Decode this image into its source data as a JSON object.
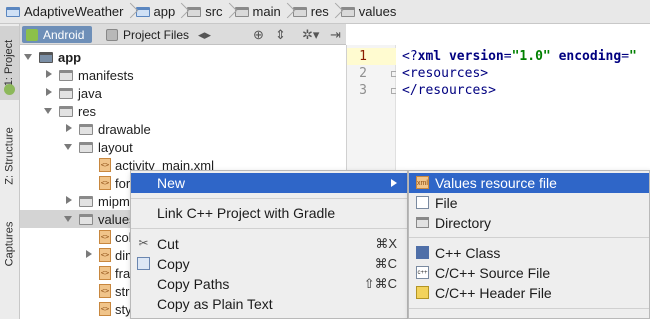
{
  "breadcrumb": [
    "AdaptiveWeather",
    "app",
    "src",
    "main",
    "res",
    "values"
  ],
  "side_tabs": {
    "project": "1: Project",
    "structure": "Z: Structure",
    "captures": "Captures"
  },
  "project_header": {
    "android_tab": "Android",
    "project_files_tab": "Project Files"
  },
  "tree": [
    {
      "label": "app",
      "type": "app",
      "arrow": "down"
    },
    {
      "label": "manifests",
      "type": "folder",
      "arrow": "right"
    },
    {
      "label": "java",
      "type": "folder",
      "arrow": "right"
    },
    {
      "label": "res",
      "type": "folder",
      "arrow": "down"
    },
    {
      "label": "drawable",
      "type": "folder",
      "arrow": "right"
    },
    {
      "label": "layout",
      "type": "folder",
      "arrow": "down"
    },
    {
      "label": "activity_main.xml",
      "type": "xml",
      "arrow": ""
    },
    {
      "label": "fore",
      "type": "xml",
      "arrow": ""
    },
    {
      "label": "mipma",
      "type": "folder",
      "arrow": "right"
    },
    {
      "label": "values",
      "type": "folder",
      "arrow": "down"
    },
    {
      "label": "col",
      "type": "xml",
      "arrow": ""
    },
    {
      "label": "dim",
      "type": "xml",
      "arrow": "right"
    },
    {
      "label": "frag",
      "type": "xml",
      "arrow": ""
    },
    {
      "label": "stri",
      "type": "xml",
      "arrow": ""
    },
    {
      "label": "sty",
      "type": "xml",
      "arrow": ""
    }
  ],
  "editor": {
    "line_numbers": [
      "1",
      "2",
      "3"
    ],
    "line1": {
      "p1": "<?",
      "kw1": "xml ",
      "kw2": "version",
      "eq1": "=",
      "v1": "\"1.0\" ",
      "kw3": "encoding",
      "eq2": "=",
      "v2": "\""
    },
    "line2": "<resources>",
    "line3": "</resources>"
  },
  "context_menu": {
    "items": [
      {
        "label": "New",
        "shortcut": "",
        "icon": "",
        "highlighted": true,
        "submenu": true
      },
      {
        "label": "Link C++ Project with Gradle",
        "shortcut": "",
        "icon": ""
      },
      {
        "label": "Cut",
        "shortcut": "⌘X",
        "icon": "scissors-icon"
      },
      {
        "label": "Copy",
        "shortcut": "⌘C",
        "icon": "copy-icon"
      },
      {
        "label": "Copy Paths",
        "shortcut": "⇧⌘C",
        "icon": ""
      },
      {
        "label": "Copy as Plain Text",
        "shortcut": "",
        "icon": ""
      }
    ]
  },
  "submenu": {
    "items": [
      {
        "label": "Values resource file",
        "icon": "values-file-icon",
        "highlighted": true
      },
      {
        "label": "File",
        "icon": "file-icon"
      },
      {
        "label": "Directory",
        "icon": "directory-icon"
      },
      {
        "label": "C++ Class",
        "icon": "cpp-class-icon"
      },
      {
        "label": "C/C++ Source File",
        "icon": "cpp-source-icon"
      },
      {
        "label": "C/C++ Header File",
        "icon": "cpp-header-icon"
      }
    ]
  },
  "colors": {
    "highlight": "#2f66c8",
    "selected_tab": "#6e8fb8",
    "menu_bg": "#eeeeee"
  }
}
